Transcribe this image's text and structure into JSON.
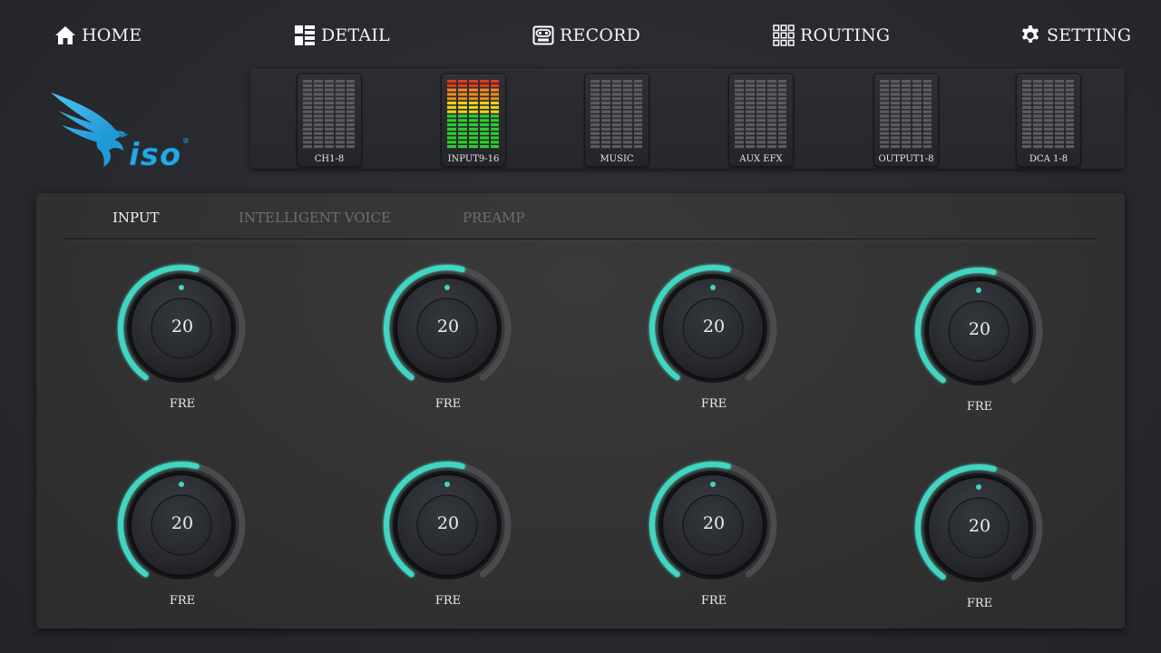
{
  "nav": {
    "home": "HOME",
    "detail": "DETAIL",
    "record": "RECORD",
    "routing": "ROUTING",
    "setting": "SETTING"
  },
  "logo": {
    "text": "iso",
    "registered": "®"
  },
  "meters": [
    {
      "label": "CH1-8",
      "active": false
    },
    {
      "label": "INPUT9-16",
      "active": true
    },
    {
      "label": "MUSIC",
      "active": false
    },
    {
      "label": "AUX EFX",
      "active": false
    },
    {
      "label": "OUTPUT1-8",
      "active": false
    },
    {
      "label": "DCA 1-8",
      "active": false
    }
  ],
  "tabs": {
    "input": "INPUT",
    "voice": "INTELLIGENT VOICE",
    "preamp": "PREAMP"
  },
  "knobs": [
    {
      "value": "20",
      "label": "FRE",
      "level": 0.55
    },
    {
      "value": "20",
      "label": "FRE",
      "level": 0.55
    },
    {
      "value": "20",
      "label": "FRE",
      "level": 0.55
    },
    {
      "value": "20",
      "label": "FRE",
      "level": 0.55
    },
    {
      "value": "20",
      "label": "FRE",
      "level": 0.55
    },
    {
      "value": "20",
      "label": "FRE",
      "level": 0.55
    },
    {
      "value": "20",
      "label": "FRE",
      "level": 0.55
    },
    {
      "value": "20",
      "label": "FRE",
      "level": 0.55
    }
  ],
  "colors": {
    "accent": "#3fd6c1",
    "meter_idle": "#5a5c60",
    "meter_green": "#2ecc2e",
    "meter_yellow": "#e8d21a",
    "meter_red": "#e23a1c",
    "logo_blue": "#26a9e6"
  }
}
